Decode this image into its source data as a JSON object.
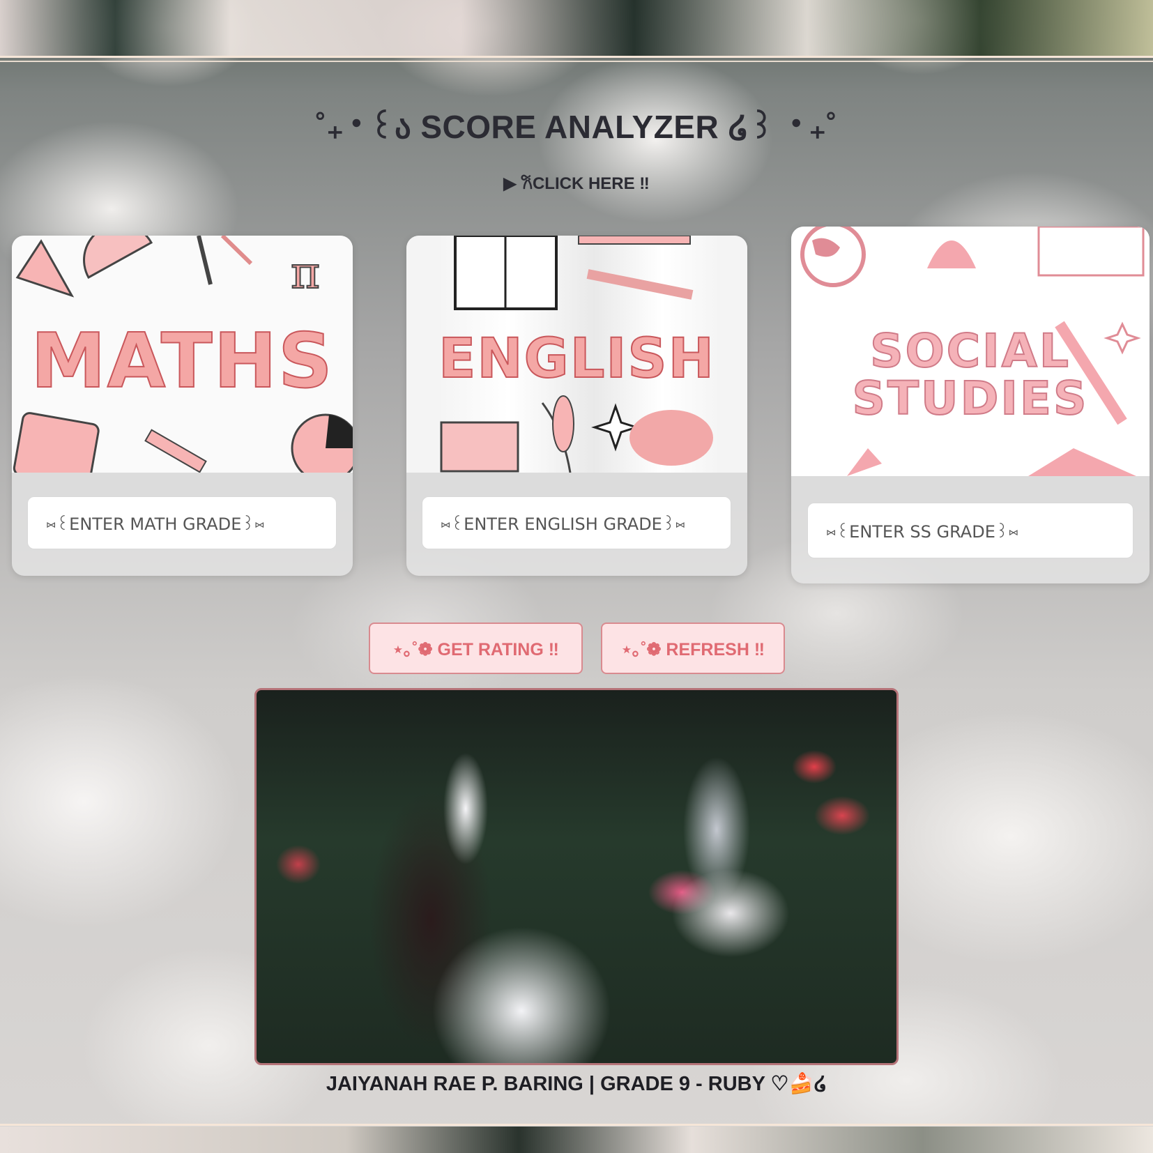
{
  "header": {
    "title": "˚₊‧꒰ა SCORE ANALYZER ໒꒱ ‧₊˚",
    "click_label": "▶ 𐙚CLICK HERE ‼"
  },
  "cards": [
    {
      "subject": "MATHS",
      "placeholder": "⑅꒰ENTER MATH GRADE꒱⑅"
    },
    {
      "subject": "ENGLISH",
      "placeholder": "⑅꒰ENTER ENGLISH GRADE꒱⑅"
    },
    {
      "subject_line1": "SOCIAL",
      "subject_line2": "STUDIES",
      "placeholder": "⑅꒰ENTER SS GRADE꒱⑅"
    }
  ],
  "buttons": {
    "rating": "⋆｡˚❁ GET RATING ‼",
    "refresh": "⋆｡˚❁ REFRESH ‼"
  },
  "footer": {
    "caption": "JAIYANAH RAE P. BARING | GRADE 9 - RUBY ♡🍰໒"
  },
  "colors": {
    "accent_pink": "#f4a7a5",
    "button_bg": "#fde3e5",
    "button_text": "#e06a72",
    "frame_border": "#b67479"
  },
  "icons": [
    "triangle-ruler-icon",
    "protractor-icon",
    "pencil-icon",
    "pi-icon",
    "calculator-icon",
    "pie-chart-icon",
    "book-icon",
    "feather-icon",
    "laptop-icon",
    "sparkle-icon",
    "globe-icon",
    "bell-icon",
    "calendar-icon"
  ]
}
